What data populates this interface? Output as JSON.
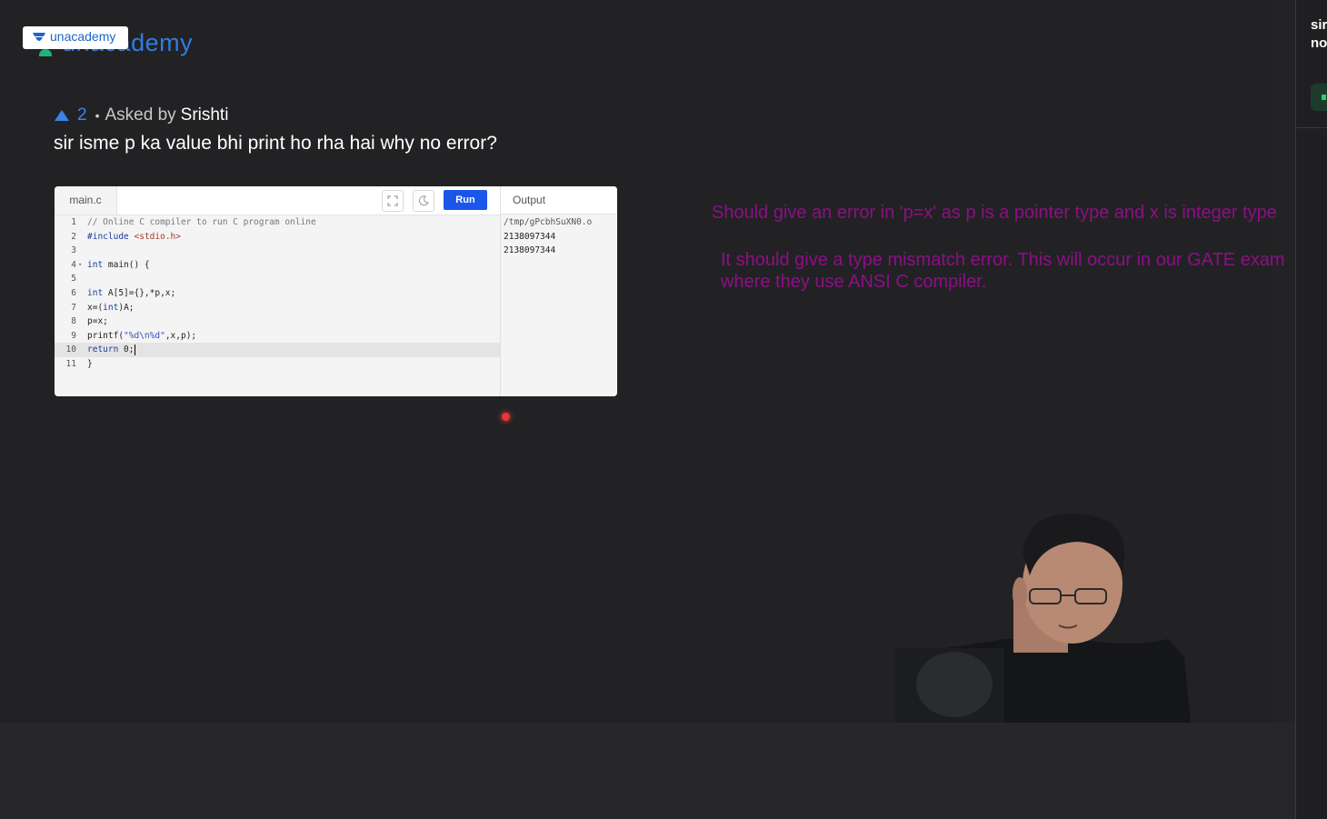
{
  "brand": {
    "watermark": "unacademy",
    "badge": "unacademy"
  },
  "question": {
    "votes": "2",
    "separator": "•",
    "asked_label": "Asked by",
    "asker": "Srishti",
    "text": "sir isme p ka value bhi print ho rha hai why no error?"
  },
  "compiler": {
    "file_tab": "main.c",
    "run_label": "Run",
    "output_header": "Output",
    "icons": [
      "fullscreen-icon",
      "moon-icon"
    ],
    "output_lines": [
      "/tmp/gPcbhSuXN0.o",
      "2138097344",
      "2138097344"
    ]
  },
  "notes": {
    "line1": "Should give an error in 'p=x' as p is a pointer type and x is integer type",
    "line2": "It should give a type mismatch error. This will occur in our GATE exam",
    "line3": "where they use ANSI C compiler.",
    "color": "#8c0f86"
  },
  "right_rail": {
    "text_line1": "sir",
    "text_line2": "no"
  },
  "colors": {
    "accent": "#3c82e9",
    "run_button": "#1a56e8",
    "background": "#222224"
  }
}
